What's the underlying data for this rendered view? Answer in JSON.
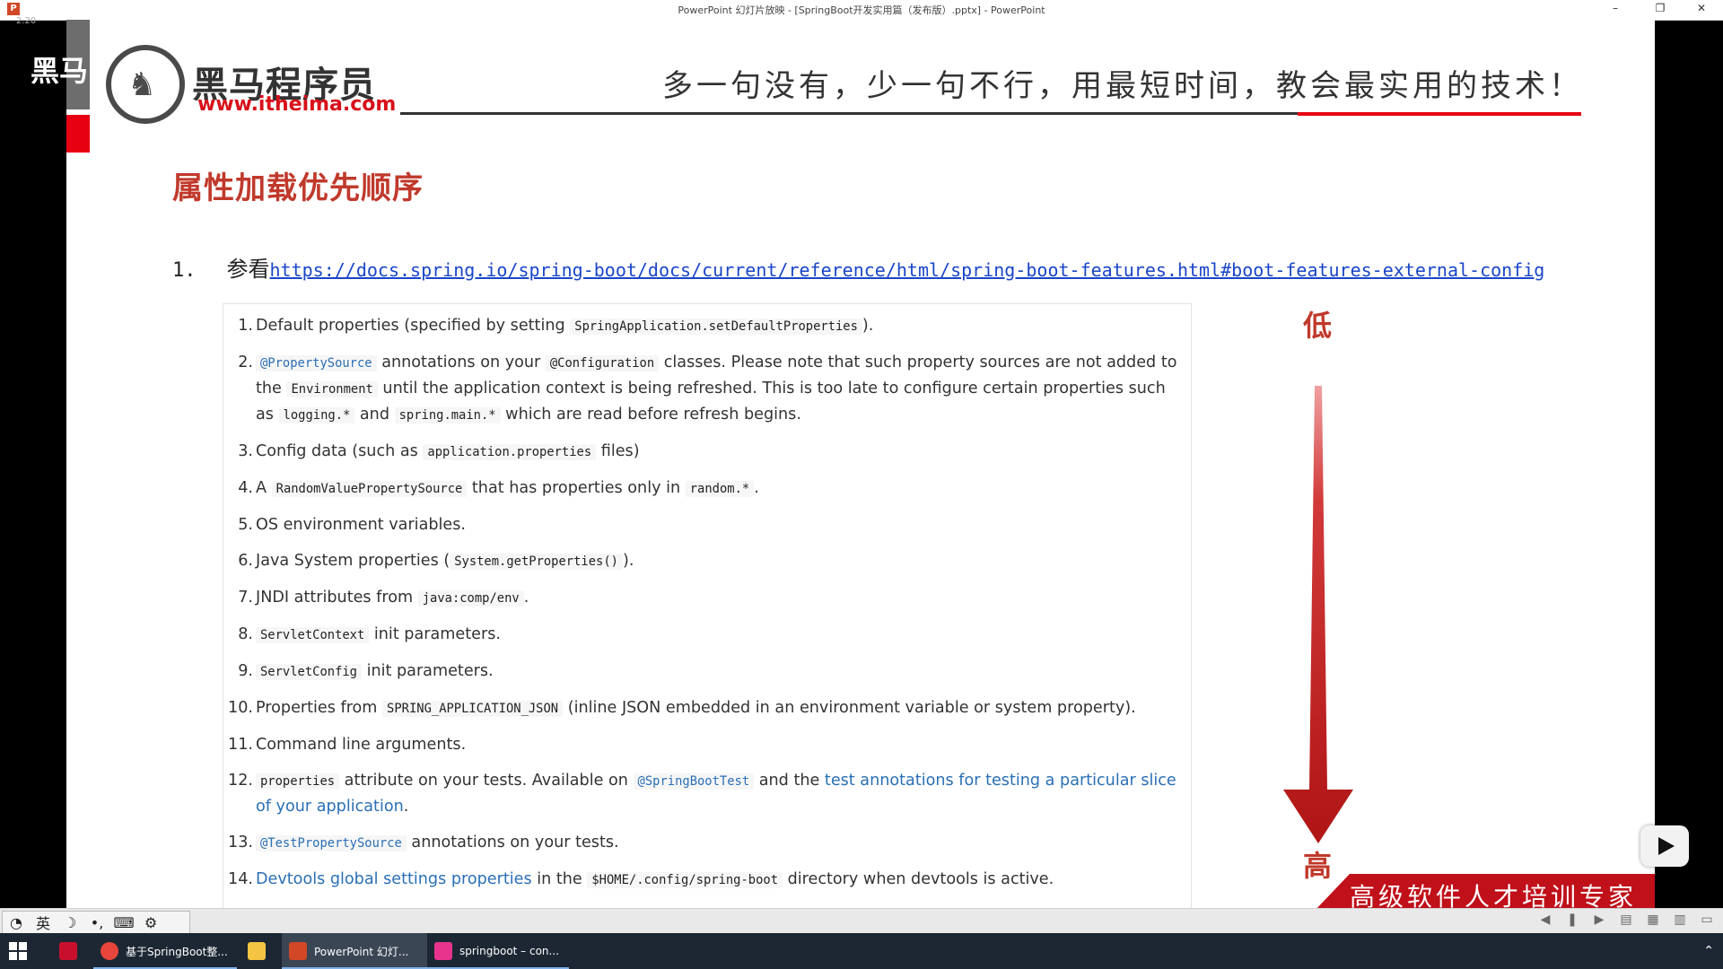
{
  "window": {
    "title": "PowerPoint 幻灯片放映 - [SpringBoot开发实用篇（发布版）.pptx] - PowerPoint",
    "corner_time": "2.20",
    "controls": [
      "–",
      "❐",
      "✕"
    ]
  },
  "slide": {
    "overlay_logo_text": "黑马",
    "logo_cn": "黑马程序员",
    "logo_url": "www.itheima.com",
    "slogan": "多一句没有，少一句不行，用最短时间，教会最实用的技术！",
    "heading": "属性加载优先顺序",
    "ref_number": "1.",
    "ref_lead": "参看",
    "ref_link": "https://docs.spring.io/spring-boot/docs/current/reference/html/spring-boot-features.html#boot-features-external-config",
    "label_low": "低",
    "label_high": "高",
    "footer": "高级软件人才培训专家",
    "colors": {
      "accent_red": "#c0392b",
      "brand_red": "#e60012",
      "link_blue": "#1a45c8"
    }
  },
  "doc_items": {
    "i1": {
      "n": "1.",
      "t1": "Default properties (specified by setting ",
      "c1": "SpringApplication.setDefaultProperties",
      "t2": ")."
    },
    "i2": {
      "n": "2.",
      "c1": "@PropertySource",
      "t1": " annotations on your ",
      "c2": "@Configuration",
      "t2": " classes. Please note that such property sources are not added to the ",
      "c3": "Environment",
      "t3": " until the application context is being refreshed. This is too late to configure certain properties such as ",
      "c4": "logging.*",
      "t4": " and ",
      "c5": "spring.main.*",
      "t5": " which are read before refresh begins."
    },
    "i3": {
      "n": "3.",
      "t1": "Config data (such as ",
      "c1": "application.properties",
      "t2": " files)"
    },
    "i4": {
      "n": "4.",
      "t1": "A ",
      "c1": "RandomValuePropertySource",
      "t2": " that has properties only in ",
      "c2": "random.*",
      "t3": "."
    },
    "i5": {
      "n": "5.",
      "t1": "OS environment variables."
    },
    "i6": {
      "n": "6.",
      "t1": "Java System properties (",
      "c1": "System.getProperties()",
      "t2": ")."
    },
    "i7": {
      "n": "7.",
      "t1": "JNDI attributes from ",
      "c1": "java:comp/env",
      "t2": "."
    },
    "i8": {
      "n": "8.",
      "c1": "ServletContext",
      "t1": " init parameters."
    },
    "i9": {
      "n": "9.",
      "c1": "ServletConfig",
      "t1": " init parameters."
    },
    "i10": {
      "n": "10.",
      "t1": "Properties from ",
      "c1": "SPRING_APPLICATION_JSON",
      "t2": " (inline JSON embedded in an environment variable or system property)."
    },
    "i11": {
      "n": "11.",
      "t1": "Command line arguments."
    },
    "i12": {
      "n": "12.",
      "c1": "properties",
      "t1": " attribute on your tests. Available on ",
      "c2": "@SpringBootTest",
      "t2": " and the ",
      "l1": "test annotations for testing a particular slice of your application",
      "t3": "."
    },
    "i13": {
      "n": "13.",
      "c1": "@TestPropertySource",
      "t1": " annotations on your tests."
    },
    "i14": {
      "n": "14.",
      "l1": "Devtools global settings properties",
      "t1": " in the ",
      "c1": "$HOME/.config/spring-boot",
      "t2": " directory when devtools is active."
    }
  },
  "ime": {
    "items": [
      "◔",
      "英",
      "☽",
      "•,",
      "⌨",
      "⚙"
    ]
  },
  "taskbar": {
    "apps": [
      {
        "label": "基于SpringBoot整...",
        "icon_color": "#e8453c"
      },
      {
        "label": "",
        "icon_color": "#f4c542"
      },
      {
        "label": "PowerPoint 幻灯...",
        "icon_color": "#d24726"
      },
      {
        "label": "springboot – con...",
        "icon_color": "#e8348c"
      }
    ]
  }
}
